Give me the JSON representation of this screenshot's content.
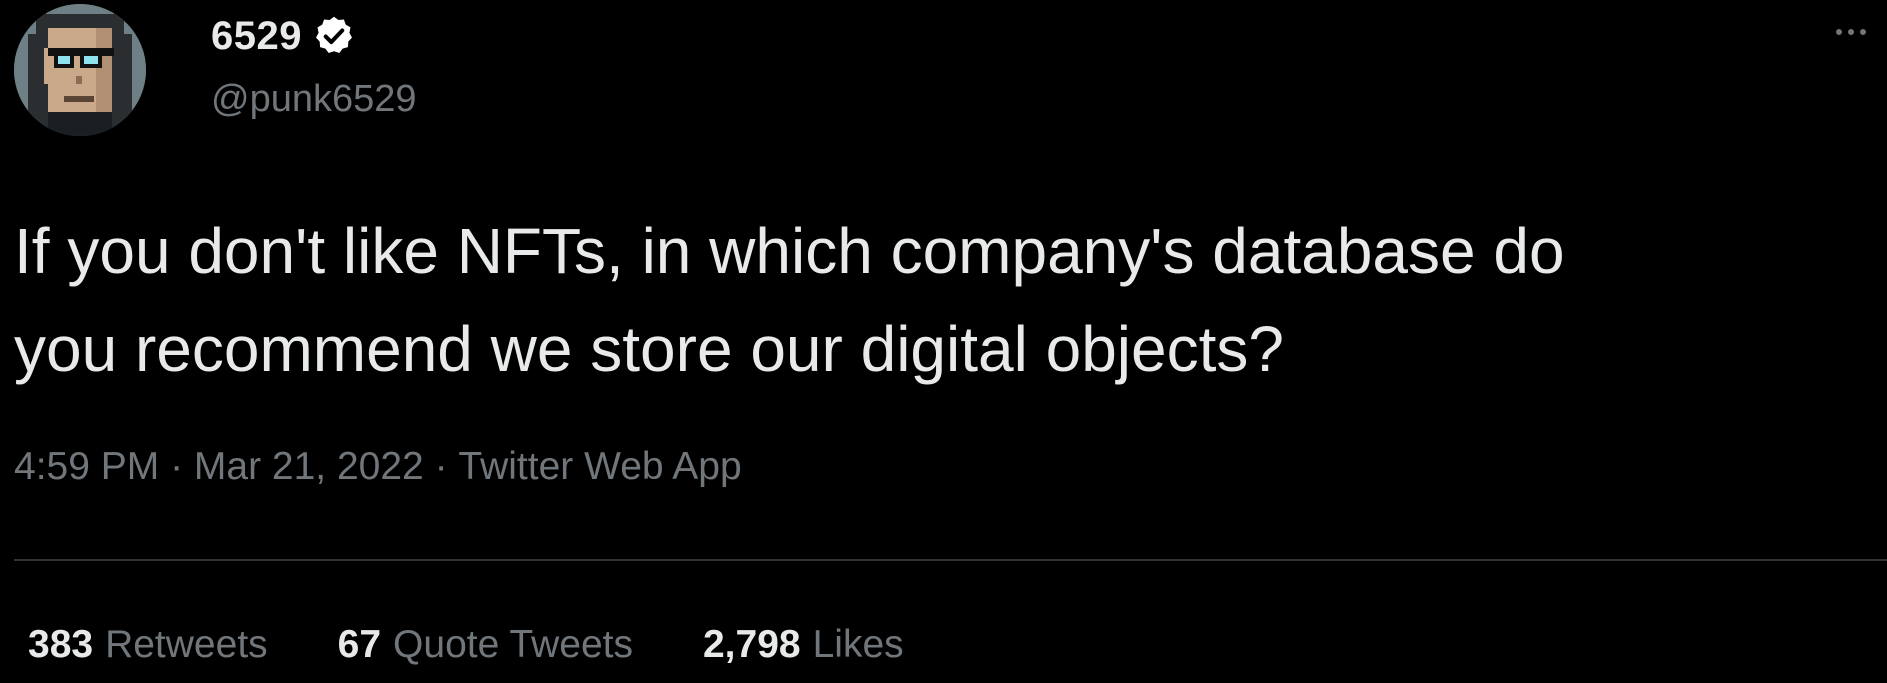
{
  "author": {
    "display_name": "6529",
    "handle": "@punk6529",
    "verified": true,
    "avatar_icon": "pixel-punk-avatar-icon",
    "verified_icon": "verified-check-icon"
  },
  "tweet": {
    "text": "If you don't like NFTs, in which company's database do\nyou recommend we store our digital objects?",
    "time": "4:59 PM",
    "date": "Mar 21, 2022",
    "source": "Twitter Web App",
    "separator": " · "
  },
  "stats": {
    "retweets": {
      "count": "383",
      "label": "Retweets"
    },
    "quotes": {
      "count": "67",
      "label": "Quote Tweets"
    },
    "likes": {
      "count": "2,798",
      "label": "Likes"
    }
  },
  "menu": {
    "icon": "more-options-icon"
  },
  "colors": {
    "background": "#000000",
    "primary_text": "#e7e9ea",
    "secondary_text": "#71767b",
    "divider": "#2f3336",
    "verified_badge": "#ffffff"
  }
}
